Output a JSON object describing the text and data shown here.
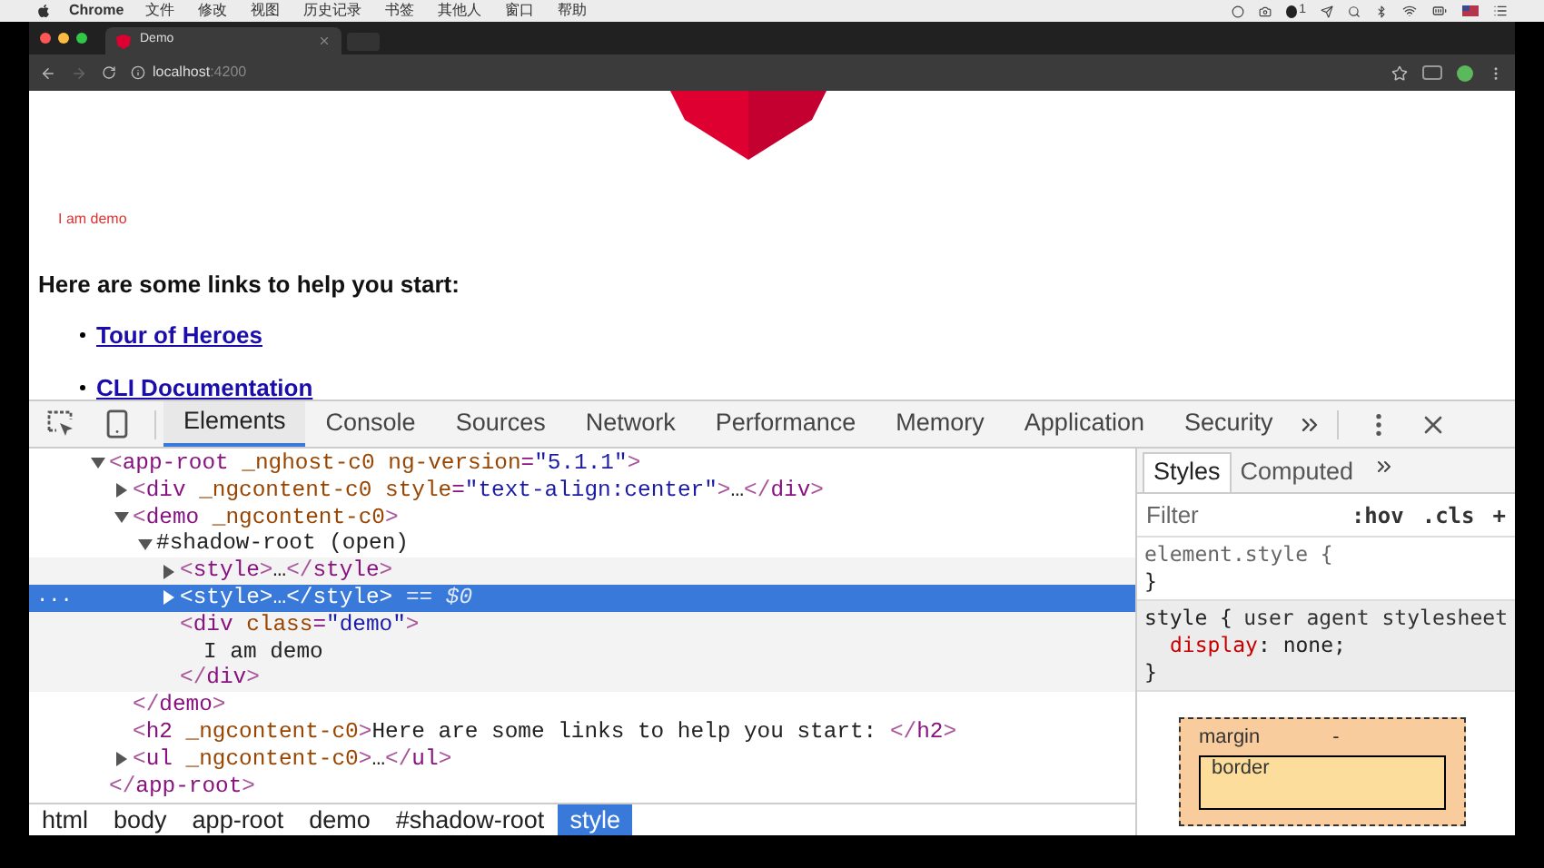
{
  "menu_bar": {
    "app": "Chrome",
    "items": [
      "文件",
      "修改",
      "视图",
      "历史记录",
      "书签",
      "其他人",
      "窗口",
      "帮助"
    ],
    "badge": "1"
  },
  "browser": {
    "tabs": [
      {
        "title": "Demo",
        "selected": true
      }
    ],
    "address": {
      "host": "localhost",
      "port": ":4200"
    }
  },
  "page": {
    "demo_text": "I am demo",
    "heading": "Here are some links to help you start:",
    "links": [
      "Tour of Heroes",
      "CLI Documentation"
    ]
  },
  "devtools": {
    "tabs": [
      {
        "label": "Elements",
        "selected": true
      },
      {
        "label": "Console",
        "selected": false
      },
      {
        "label": "Sources",
        "selected": false
      },
      {
        "label": "Network",
        "selected": false
      },
      {
        "label": "Performance",
        "selected": false
      },
      {
        "label": "Memory",
        "selected": false
      },
      {
        "label": "Application",
        "selected": false
      },
      {
        "label": "Security",
        "selected": false
      }
    ],
    "gutter_mark": "...",
    "dom_tree": [
      {
        "open": "<app-root _nghost-c0 ng-version=\"5.1.1\">",
        "close": "</app-root>",
        "expanded": true,
        "selected": false,
        "children": [
          {
            "open": "<div _ngcontent-c0 style=\"text-align:center\">…</div>",
            "expanded": false,
            "selected": false
          },
          {
            "open": "<demo _ngcontent-c0>",
            "close": "</demo>",
            "expanded": true,
            "selected": false,
            "children": [
              {
                "open": "#shadow-root (open)",
                "kind": "shadow-root",
                "expanded": true,
                "selected": false,
                "children": [
                  {
                    "open": "<style>…</style>",
                    "expanded": false,
                    "selected": false
                  },
                  {
                    "open": "<style>…</style>",
                    "suffix": "== $0",
                    "expanded": false,
                    "selected": true
                  },
                  {
                    "open": "<div class=\"demo\">",
                    "close": "</div>",
                    "selected": false,
                    "children": [
                      {
                        "open": "I am demo",
                        "selected": false
                      }
                    ]
                  }
                ]
              }
            ]
          },
          {
            "open": "<h2 _ngcontent-c0>Here are some links to help you start: </h2>",
            "selected": false
          },
          {
            "open": "<ul _ngcontent-c0>…</ul>",
            "expanded": false,
            "selected": false
          }
        ]
      }
    ],
    "breadcrumbs": [
      {
        "label": "html",
        "selected": false
      },
      {
        "label": "body",
        "selected": false
      },
      {
        "label": "app-root",
        "selected": false
      },
      {
        "label": "demo",
        "selected": false
      },
      {
        "label": "#shadow-root",
        "selected": false
      },
      {
        "label": "style",
        "selected": true
      }
    ],
    "styles_pane": {
      "tabs": [
        {
          "label": "Styles",
          "selected": true
        },
        {
          "label": "Computed",
          "selected": false
        }
      ],
      "filter": {
        "placeholder": "Filter"
      },
      "buttons": [
        ":hov",
        ".cls",
        "+"
      ],
      "rules": [
        {
          "kind": "inline",
          "selector": "element.style {",
          "close": "}"
        },
        {
          "kind": "user-agent",
          "selector": "style {",
          "origin": "user agent stylesheet",
          "declarations": [
            "display: none;"
          ],
          "close": "}"
        }
      ],
      "box_model": {
        "margin_label": "margin",
        "margin_value": "-",
        "border_label": "border"
      }
    }
  }
}
